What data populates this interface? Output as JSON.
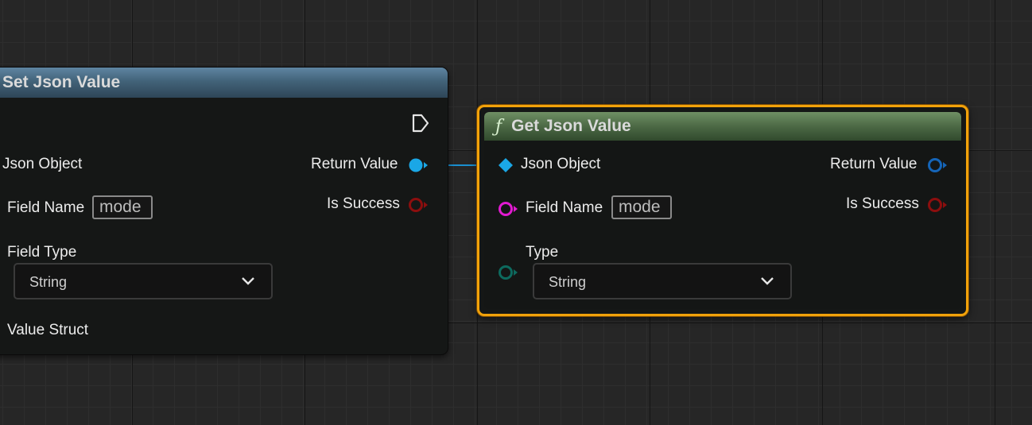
{
  "set_node": {
    "title": "Set Json Value",
    "inputs": {
      "json_object": "Json Object",
      "field_name": "Field Name",
      "field_name_value": "mode",
      "field_type": "Field Type",
      "field_type_value": "String",
      "value_struct": "Value Struct"
    },
    "outputs": {
      "return_value": "Return Value",
      "is_success": "Is Success"
    },
    "header_color": "#4a6d86"
  },
  "get_node": {
    "title": "Get Json Value",
    "title_icon": "function-icon",
    "inputs": {
      "json_object": "Json Object",
      "field_name": "Field Name",
      "field_name_value": "mode",
      "type": "Type",
      "type_value": "String"
    },
    "outputs": {
      "return_value": "Return Value",
      "is_success": "Is Success"
    },
    "header_color": "#587a4f",
    "selected_outline_color": "#f2a20a"
  },
  "pin_colors": {
    "json_object": "#1aa7e6",
    "bool": "#8c0e0e",
    "string": "#e21ad1",
    "enum": "#0d6a5e",
    "exec": "#e6e6e6"
  }
}
